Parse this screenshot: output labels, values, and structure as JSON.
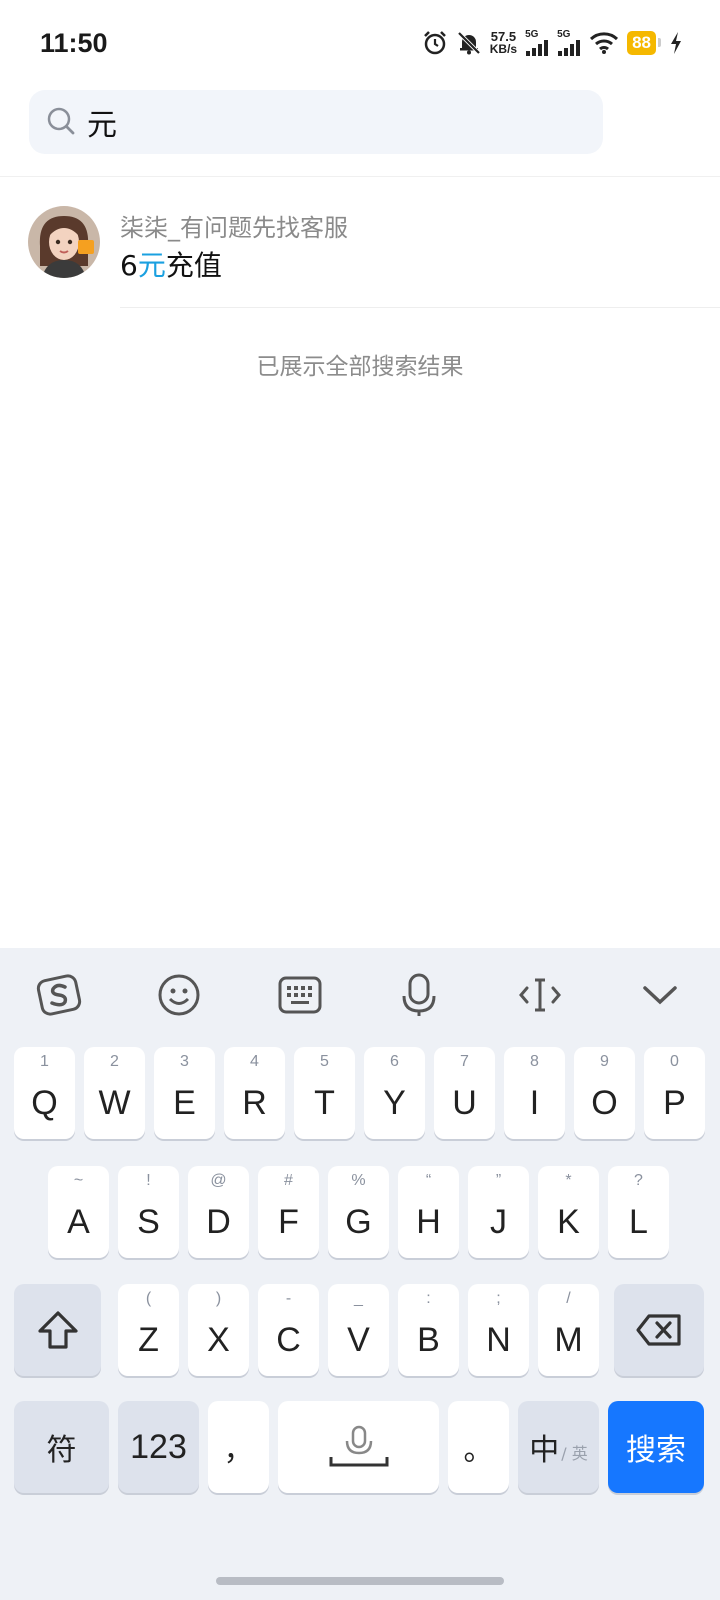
{
  "status_bar": {
    "time": "11:50",
    "net_speed_value": "57.5",
    "net_speed_unit": "KB/s",
    "signal1_label": "5G",
    "signal2_label": "5G",
    "battery": "88"
  },
  "search": {
    "query": "元"
  },
  "results": [
    {
      "name": "柒柒_有问题先找客服",
      "text_before": "6",
      "text_highlight": "元",
      "text_after": "充值"
    }
  ],
  "end_note": "已展示全部搜索结果",
  "keyboard": {
    "toolbar_icons": [
      "sogou-logo-icon",
      "emoji-icon",
      "keyboard-icon",
      "microphone-icon",
      "cursor-icon",
      "chevron-down-icon"
    ],
    "row1": [
      {
        "main": "Q",
        "sub": "1"
      },
      {
        "main": "W",
        "sub": "2"
      },
      {
        "main": "E",
        "sub": "3"
      },
      {
        "main": "R",
        "sub": "4"
      },
      {
        "main": "T",
        "sub": "5"
      },
      {
        "main": "Y",
        "sub": "6"
      },
      {
        "main": "U",
        "sub": "7"
      },
      {
        "main": "I",
        "sub": "8"
      },
      {
        "main": "O",
        "sub": "9"
      },
      {
        "main": "P",
        "sub": "0"
      }
    ],
    "row2": [
      {
        "main": "A",
        "sub": "~"
      },
      {
        "main": "S",
        "sub": "!"
      },
      {
        "main": "D",
        "sub": "@"
      },
      {
        "main": "F",
        "sub": "#"
      },
      {
        "main": "G",
        "sub": "%"
      },
      {
        "main": "H",
        "sub": "“"
      },
      {
        "main": "J",
        "sub": "”"
      },
      {
        "main": "K",
        "sub": "*"
      },
      {
        "main": "L",
        "sub": "?"
      }
    ],
    "row3": [
      {
        "main": "Z",
        "sub": "("
      },
      {
        "main": "X",
        "sub": ")"
      },
      {
        "main": "C",
        "sub": "-"
      },
      {
        "main": "V",
        "sub": "_"
      },
      {
        "main": "B",
        "sub": ":"
      },
      {
        "main": "N",
        "sub": ";"
      },
      {
        "main": "M",
        "sub": "/"
      }
    ],
    "symbols_label": "符",
    "numbers_label": "123",
    "comma_label": "，",
    "period_label": "。",
    "lang_main": "中",
    "lang_sub": "/ 英",
    "search_label": "搜索"
  }
}
